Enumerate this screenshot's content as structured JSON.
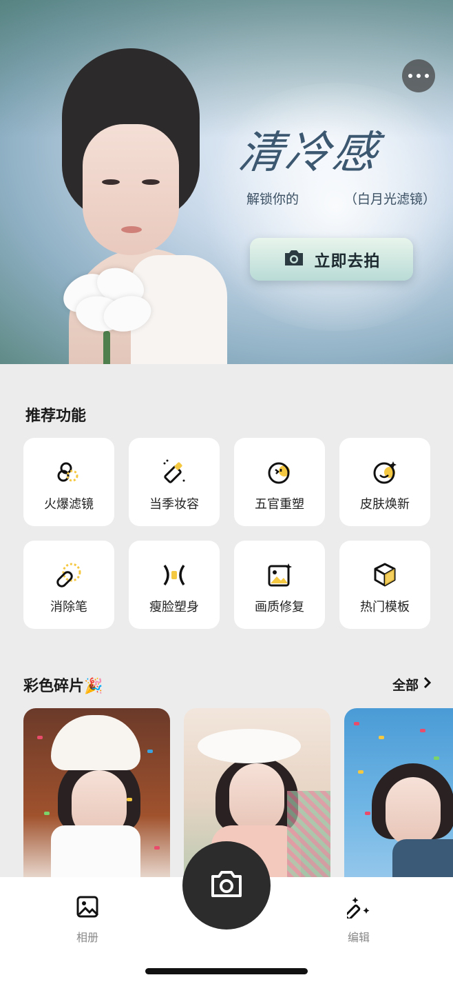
{
  "hero": {
    "title": "清冷感",
    "subtitle_left": "解锁你的",
    "subtitle_right": "（白月光滤镜）",
    "cta_label": "立即去拍"
  },
  "features": {
    "title": "推荐功能",
    "items": [
      {
        "label": "火爆滤镜",
        "icon": "filter-icon"
      },
      {
        "label": "当季妆容",
        "icon": "makeup-icon"
      },
      {
        "label": "五官重塑",
        "icon": "face-reshape-icon"
      },
      {
        "label": "皮肤焕新",
        "icon": "skin-icon"
      },
      {
        "label": "消除笔",
        "icon": "eraser-icon"
      },
      {
        "label": "瘦脸塑身",
        "icon": "slim-icon"
      },
      {
        "label": "画质修复",
        "icon": "image-repair-icon"
      },
      {
        "label": "热门模板",
        "icon": "template-icon"
      }
    ]
  },
  "gallery": {
    "title": "彩色碎片🎉",
    "see_all": "全部"
  },
  "bottom_nav": {
    "album_label": "相册",
    "edit_label": "编辑"
  },
  "colors": {
    "accent_yellow": "#f5c842",
    "fab": "#2c2c2c"
  }
}
